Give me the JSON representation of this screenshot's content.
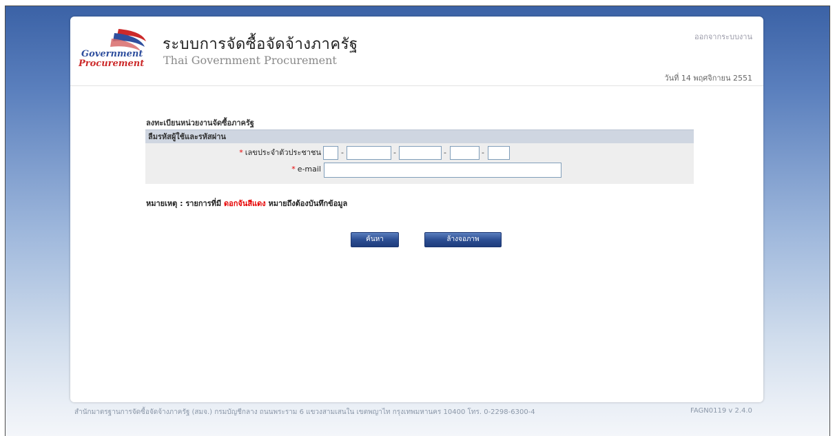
{
  "header": {
    "title_th": "ระบบการจัดซื้อจัดจ้างภาครัฐ",
    "title_en": "Thai Government Procurement",
    "logo_text_line1": "Government",
    "logo_text_line2": "Procurement",
    "logout_link": "ออกจากระบบงาน",
    "date": "วันที่ 14 พฤศจิกายน 2551"
  },
  "form": {
    "title": "ลงทะเบียนหน่วยงานจัดซื้อภาครัฐ",
    "section_header": "ลืมรหัสผู้ใช้และรหัสผ่าน",
    "id_label": "เลขประจำตัวประชาชน",
    "id_fields": [
      "",
      "",
      "",
      "",
      ""
    ],
    "dash": "-",
    "email_label": "e-mail",
    "email_value": "",
    "required_mark": "*"
  },
  "note": {
    "prefix": "หมายเหตุ : รายการที่มี ",
    "highlight": "ดอกจันสีแดง",
    "suffix": " หมายถึงต้องบันทึกข้อมูล"
  },
  "buttons": {
    "search": "ค้นหา",
    "clear": "ล้างจอภาพ"
  },
  "footer": {
    "address": "สำนักมาตรฐานการจัดซื้อจัดจ้างภาครัฐ (สมจ.) กรมบัญชีกลาง ถนนพระราม 6 แขวงสามเสนใน เขตพญาไท กรุงเทพมหานคร 10400 โทร. 0-2298-6300-4",
    "version": "FAGN0119 v 2.4.0"
  },
  "colors": {
    "required": "#e60000",
    "button": "#2d4f93",
    "section_header": "#cfd6e1"
  }
}
